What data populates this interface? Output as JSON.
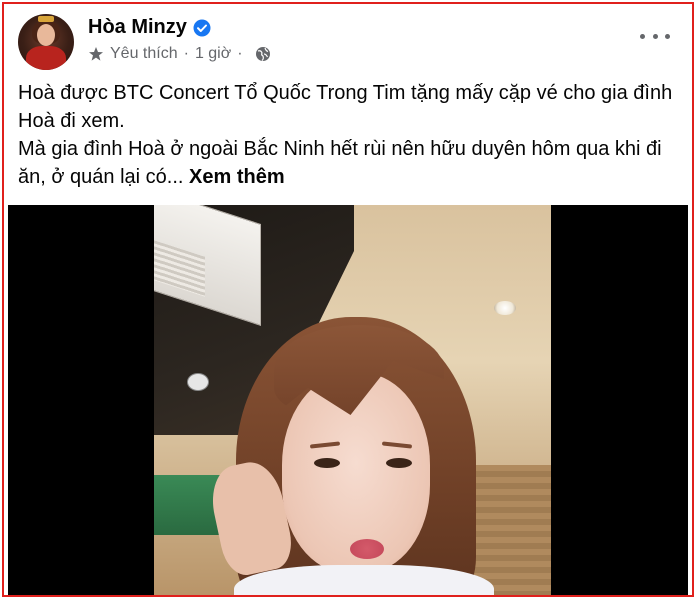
{
  "post": {
    "author": "Hòa Minzy",
    "audience_label": "Yêu thích",
    "separator": "·",
    "time": "1 giờ",
    "text_line1": "Hoà được BTC Concert Tổ Quốc Trong Tim tặng mấy cặp vé cho gia đình Hoà đi xem.",
    "text_line2": "Mà gia đình Hoà ở ngoài Bắc Ninh hết rùi nên hữu duyên hôm qua khi đi ăn, ở quán lại có...",
    "see_more": "Xem thêm"
  },
  "colors": {
    "verified": "#1877f2",
    "meta_text": "#65676b",
    "border": "#e0201c"
  },
  "icons": {
    "verified": "verified-badge-icon",
    "favorite": "star-icon",
    "privacy": "globe-icon",
    "menu": "more-options-icon"
  }
}
